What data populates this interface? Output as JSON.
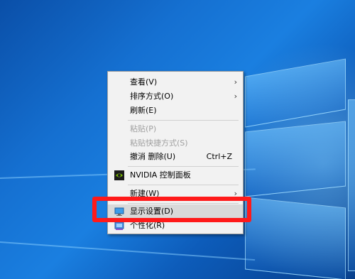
{
  "context_menu": {
    "items": [
      {
        "label": "查看(V)",
        "has_submenu": true
      },
      {
        "label": "排序方式(O)",
        "has_submenu": true
      },
      {
        "label": "刷新(E)"
      },
      {
        "label": "粘贴(P)",
        "disabled": true
      },
      {
        "label": "粘贴快捷方式(S)",
        "disabled": true
      },
      {
        "label": "撤消 删除(U)",
        "shortcut": "Ctrl+Z"
      },
      {
        "label": "NVIDIA 控制面板",
        "icon": "nvidia-icon"
      },
      {
        "label": "新建(W)",
        "has_submenu": true
      },
      {
        "label": "显示设置(D)",
        "icon": "display-settings-icon",
        "highlighted": true
      },
      {
        "label": "个性化(R)",
        "icon": "personalize-icon"
      }
    ],
    "submenu_arrow": "›"
  },
  "annotation": {
    "color": "#ff1a1a",
    "target": "显示设置(D)"
  }
}
